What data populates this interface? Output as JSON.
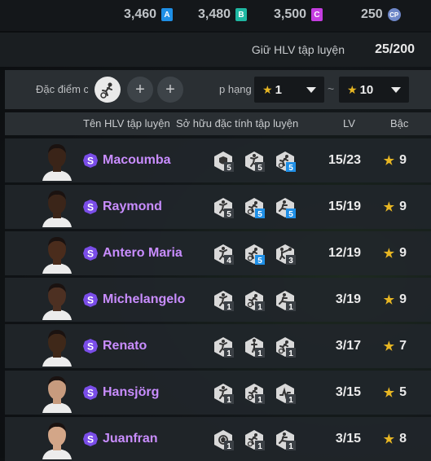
{
  "currency": [
    {
      "value": "3,460",
      "badge": "A",
      "color": "#1e8fe6"
    },
    {
      "value": "3,480",
      "badge": "B",
      "color": "#1fb8a3"
    },
    {
      "value": "3,500",
      "badge": "C",
      "color": "#c43de0"
    },
    {
      "value": "250",
      "badge": "CP",
      "color": "#6e87c8"
    }
  ],
  "keep": {
    "label": "Giữ HLV tập luyện",
    "count": "25/200"
  },
  "filter": {
    "trait_label": "Đặc điểm c",
    "rank_label": "p hạng",
    "min": "1",
    "sep": "~",
    "max": "10"
  },
  "headers": {
    "name": "Tên HLV tập luyện",
    "traits": "Sở hữu đặc tính tập luyện",
    "level": "LV",
    "grade": "Bậc"
  },
  "badge_letter": "S",
  "rows": [
    {
      "name": "Macoumba",
      "level": "15/23",
      "grade": "9",
      "skin": "#3a2418",
      "traits": [
        {
          "icon": "shield-icon",
          "lv": "5",
          "blue": false
        },
        {
          "icon": "runner-icon",
          "lv": "5",
          "blue": false
        },
        {
          "icon": "dribble-icon",
          "lv": "5",
          "blue": true
        }
      ]
    },
    {
      "name": "Raymond",
      "level": "15/19",
      "grade": "9",
      "skin": "#3b2519",
      "traits": [
        {
          "icon": "runner-icon",
          "lv": "5",
          "blue": false
        },
        {
          "icon": "dribble-icon",
          "lv": "5",
          "blue": true
        },
        {
          "icon": "kick-icon",
          "lv": "5",
          "blue": true
        }
      ]
    },
    {
      "name": "Antero Maria",
      "level": "12/19",
      "grade": "9",
      "skin": "#4a2c1c",
      "traits": [
        {
          "icon": "runner-icon",
          "lv": "4",
          "blue": false
        },
        {
          "icon": "dribble-icon",
          "lv": "5",
          "blue": true
        },
        {
          "icon": "pass-icon",
          "lv": "3",
          "blue": false
        }
      ]
    },
    {
      "name": "Michelangelo",
      "level": "3/19",
      "grade": "9",
      "skin": "#4d3022",
      "traits": [
        {
          "icon": "runner-icon",
          "lv": "1",
          "blue": false
        },
        {
          "icon": "dribble-icon",
          "lv": "1",
          "blue": false
        },
        {
          "icon": "kick-icon",
          "lv": "1",
          "blue": false
        }
      ]
    },
    {
      "name": "Renato",
      "level": "3/17",
      "grade": "7",
      "skin": "#3f2819",
      "traits": [
        {
          "icon": "runner-icon",
          "lv": "1",
          "blue": false
        },
        {
          "icon": "stand-icon",
          "lv": "1",
          "blue": false
        },
        {
          "icon": "dribble-icon",
          "lv": "1",
          "blue": false
        }
      ]
    },
    {
      "name": "Hansjörg",
      "level": "3/15",
      "grade": "5",
      "skin": "#c79b7e",
      "traits": [
        {
          "icon": "runner-icon",
          "lv": "1",
          "blue": false
        },
        {
          "icon": "dribble-icon",
          "lv": "1",
          "blue": false
        },
        {
          "icon": "wave-icon",
          "lv": "1",
          "blue": false
        }
      ]
    },
    {
      "name": "Juanfran",
      "level": "3/15",
      "grade": "8",
      "skin": "#d3a688",
      "traits": [
        {
          "icon": "ball-icon",
          "lv": "1",
          "blue": false
        },
        {
          "icon": "dribble-icon",
          "lv": "1",
          "blue": false
        },
        {
          "icon": "kick-icon",
          "lv": "1",
          "blue": false
        }
      ]
    }
  ]
}
